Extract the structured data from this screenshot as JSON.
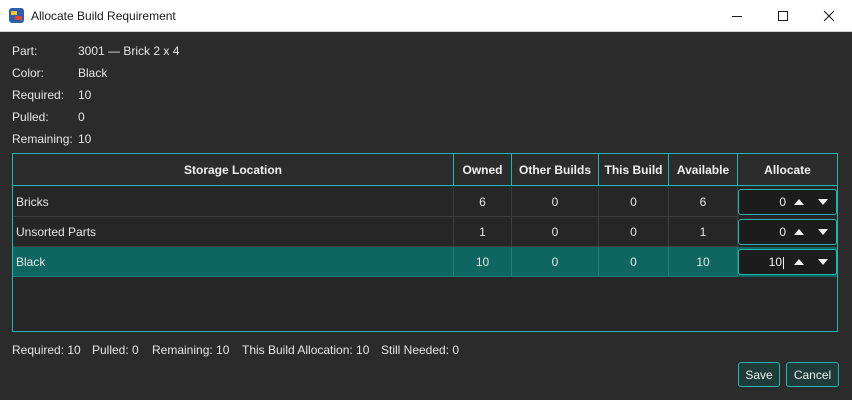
{
  "window": {
    "title": "Allocate Build Requirement",
    "icon": "lego-brick-app-icon"
  },
  "info": [
    {
      "label": "Part:",
      "value": "3001 — Brick 2 x 4"
    },
    {
      "label": "Color:",
      "value": "Black"
    },
    {
      "label": "Required:",
      "value": "10"
    },
    {
      "label": "Pulled:",
      "value": "0"
    },
    {
      "label": "Remaining:",
      "value": "10"
    }
  ],
  "table": {
    "columns": [
      "Storage Location",
      "Owned",
      "Other Builds",
      "This Build",
      "Available",
      "Allocate"
    ],
    "rows": [
      {
        "location": "Bricks",
        "owned": "6",
        "other_builds": "0",
        "this_build": "0",
        "available": "6",
        "allocate": "0",
        "selected": false
      },
      {
        "location": "Unsorted Parts",
        "owned": "1",
        "other_builds": "0",
        "this_build": "0",
        "available": "1",
        "allocate": "0",
        "selected": false
      },
      {
        "location": "Black",
        "owned": "10",
        "other_builds": "0",
        "this_build": "0",
        "available": "10",
        "allocate": "10",
        "selected": true
      }
    ]
  },
  "status": {
    "required": "Required: 10",
    "pulled": "Pulled: 0",
    "remaining": "Remaining: 10",
    "this_build_allocation": "This Build Allocation: 10",
    "still_needed": "Still Needed: 0"
  },
  "buttons": {
    "save": "Save",
    "cancel": "Cancel"
  },
  "colors": {
    "accent": "#21b7b0",
    "selected_row": "#0f6661",
    "background": "#2b2b2b"
  }
}
